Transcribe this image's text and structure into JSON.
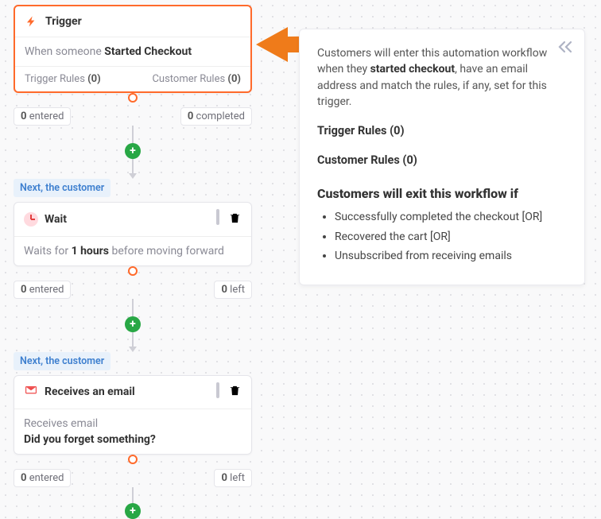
{
  "trigger": {
    "title": "Trigger",
    "action_prefix": "When someone ",
    "action_strong": "Started Checkout",
    "trigger_rules_label": "Trigger Rules ",
    "trigger_rules_count": "(0)",
    "customer_rules_label": "Customer Rules ",
    "customer_rules_count": "(0)",
    "entered_num": "0",
    "entered_word": " entered",
    "completed_num": "0",
    "completed_word": " completed"
  },
  "labels": {
    "next_customer": "Next, the customer"
  },
  "wait": {
    "title": "Wait",
    "desc_prefix": "Waits for ",
    "desc_strong": "1 hours",
    "desc_suffix": " before moving forward",
    "entered_num": "0",
    "entered_word": " entered",
    "left_num": "0",
    "left_word": " left"
  },
  "email": {
    "title": "Receives an email",
    "line1": "Receives email",
    "line2": "Did you forget something?",
    "entered_num": "0",
    "entered_word": " entered",
    "left_num": "0",
    "left_word": " left"
  },
  "panel": {
    "p_pre": "Customers will enter this automation workflow when they ",
    "p_bold": "started checkout",
    "p_post": ", have an email address and match the rules, if any, set for this trigger.",
    "trig_label": "Trigger Rules  (0)",
    "cust_label": "Customer Rules  (0)",
    "exit_heading": "Customers will exit this workflow if",
    "exit1": "Successfully completed the checkout [OR]",
    "exit2": "Recovered the cart [OR]",
    "exit3": "Unsubscribed from receiving emails"
  }
}
